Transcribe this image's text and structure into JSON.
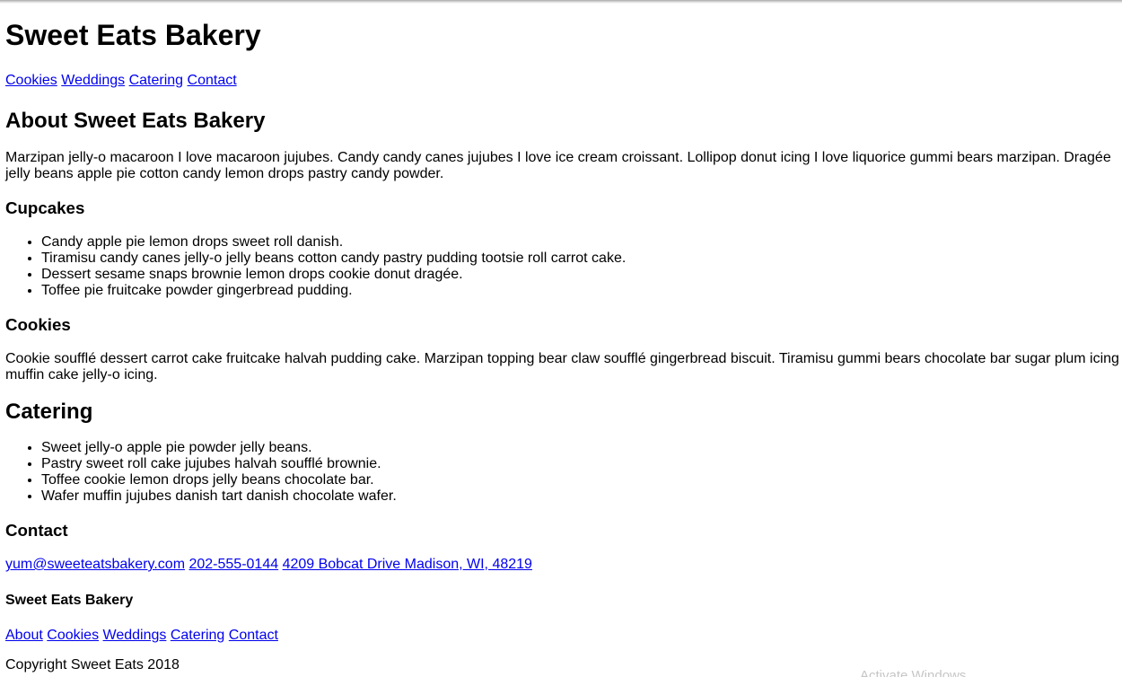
{
  "header": {
    "title": "Sweet Eats Bakery",
    "nav": [
      "Cookies",
      "Weddings",
      "Catering",
      "Contact"
    ]
  },
  "about": {
    "heading": "About Sweet Eats Bakery",
    "text": "Marzipan jelly-o macaroon I love macaroon jujubes. Candy candy canes jujubes I love ice cream croissant. Lollipop donut icing I love liquorice gummi bears marzipan. Dragée jelly beans apple pie cotton candy lemon drops pastry candy powder."
  },
  "cupcakes": {
    "heading": "Cupcakes",
    "items": [
      "Candy apple pie lemon drops sweet roll danish.",
      "Tiramisu candy canes jelly-o jelly beans cotton candy pastry pudding tootsie roll carrot cake.",
      "Dessert sesame snaps brownie lemon drops cookie donut dragée.",
      "Toffee pie fruitcake powder gingerbread pudding."
    ]
  },
  "cookies": {
    "heading": "Cookies",
    "text": "Cookie soufflé dessert carrot cake fruitcake halvah pudding cake. Marzipan topping bear claw soufflé gingerbread biscuit. Tiramisu gummi bears chocolate bar sugar plum icing muffin cake jelly-o icing."
  },
  "catering": {
    "heading": "Catering",
    "items": [
      "Sweet jelly-o apple pie powder jelly beans.",
      "Pastry sweet roll cake jujubes halvah soufflé brownie.",
      "Toffee cookie lemon drops jelly beans chocolate bar.",
      "Wafer muffin jujubes danish tart danish chocolate wafer."
    ]
  },
  "contact": {
    "heading": "Contact",
    "email": "yum@sweeteatsbakery.com",
    "phone": "202-555-0144",
    "address": "4209 Bobcat Drive Madison, WI, 48219"
  },
  "footer": {
    "title": "Sweet Eats Bakery",
    "nav": [
      "About",
      "Cookies",
      "Weddings",
      "Catering",
      "Contact"
    ],
    "copyright": "Copyright Sweet Eats 2018"
  },
  "overlay": {
    "watermark": "Activate Windows"
  },
  "colors": {
    "link": "#0000ee",
    "text": "#000000",
    "background": "#ffffff"
  }
}
